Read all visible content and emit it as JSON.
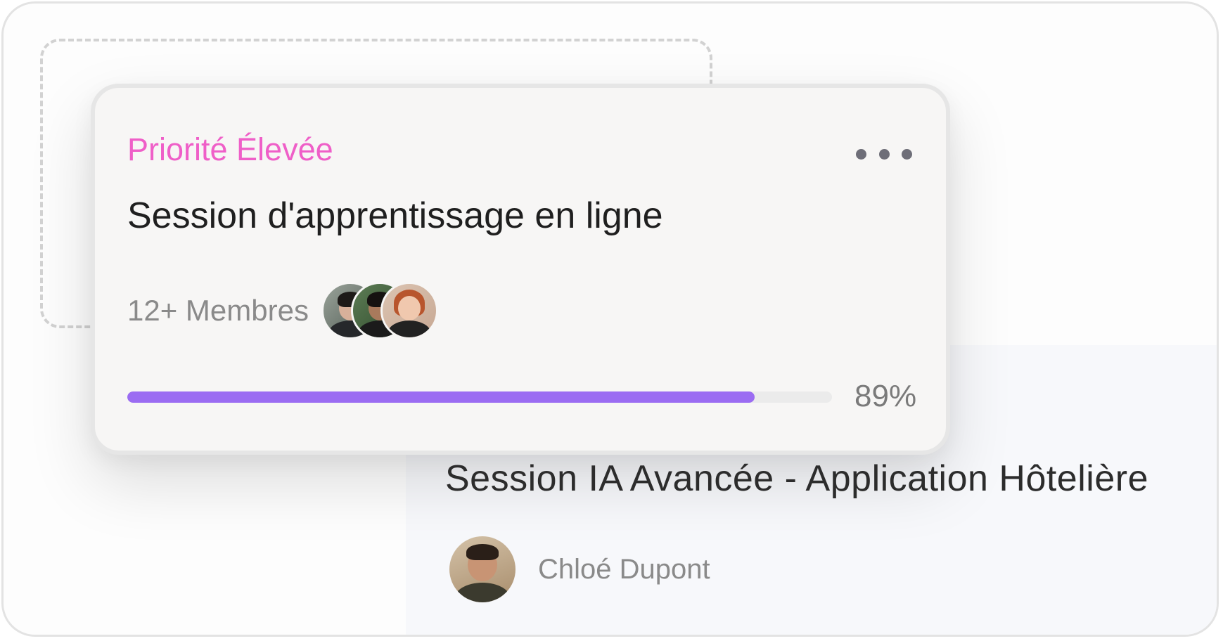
{
  "task_card": {
    "priority_label": "Priorité Élevée",
    "title": "Session d'apprentissage en ligne",
    "members_label": "12+ Membres",
    "member_avatars": [
      "avatar-man",
      "avatar-woman-glasses",
      "avatar-woman-red-hair"
    ],
    "menu_icon": "more-horizontal-icon",
    "progress_percent": 89,
    "progress_label": "89%"
  },
  "secondary_session": {
    "title": "Session IA Avancée - Application Hôtelière",
    "presenter_name": "Chloé Dupont",
    "presenter_avatar": "avatar-smiling-man"
  },
  "colors": {
    "priority": "#ef5fc8",
    "progress_fill": "#9b6cf2",
    "progress_track": "#ebebeb",
    "card_background": "#f7f6f5"
  }
}
